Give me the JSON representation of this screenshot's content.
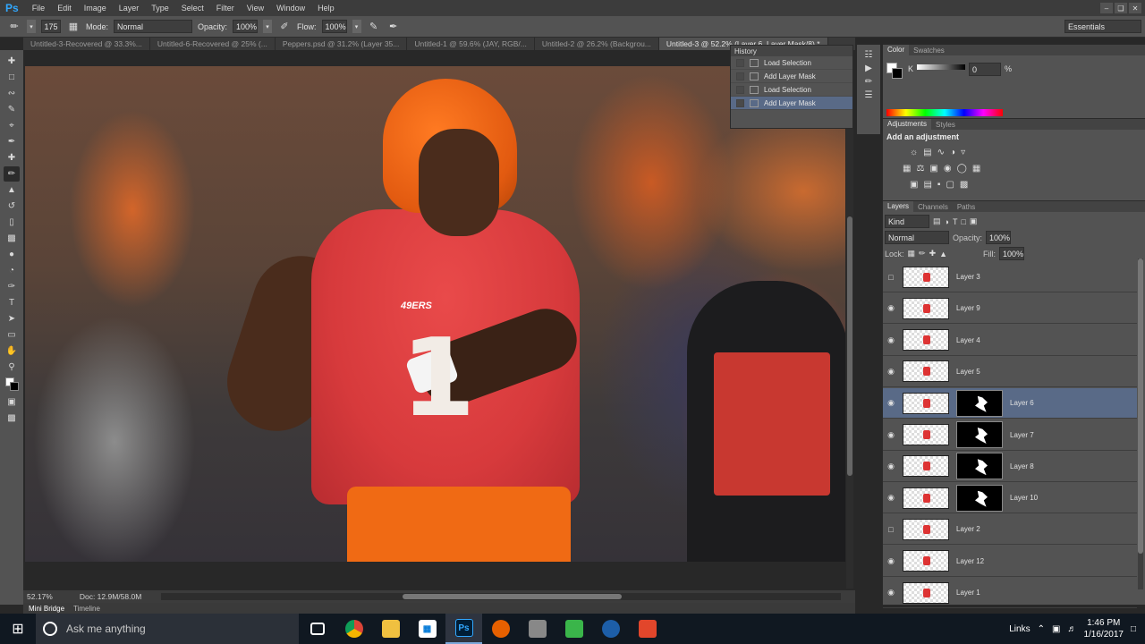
{
  "app": {
    "logo": "Ps"
  },
  "menu": [
    "File",
    "Edit",
    "Image",
    "Layer",
    "Type",
    "Select",
    "Filter",
    "View",
    "Window",
    "Help"
  ],
  "options": {
    "brush_size": "175",
    "mode_label": "Mode:",
    "mode_value": "Normal",
    "opacity_label": "Opacity:",
    "opacity_value": "100%",
    "flow_label": "Flow:",
    "flow_value": "100%",
    "workspace": "Essentials"
  },
  "tabs": [
    "Untitled-3-Recovered @ 33.3%...",
    "Untitled-6-Recovered @ 25% (...",
    "Peppers.psd @ 31.2% (Layer 35...",
    "Untitled-1 @ 59.6% (JAY, RGB/...",
    "Untitled-2 @ 26.2% (Backgrou...",
    "Untitled-3 @ 52.2% (Layer 6, Layer Mask/8) *"
  ],
  "photo": {
    "jersey_logo": "49ERS",
    "jersey_number": "1"
  },
  "status": {
    "zoom": "52.17%",
    "doc": "Doc: 12.9M/58.0M"
  },
  "bottom_tabs": {
    "bridge": "Mini Bridge",
    "timeline": "Timeline"
  },
  "history": {
    "title": "History",
    "items": [
      "Load Selection",
      "Add Layer Mask",
      "Load Selection",
      "Add Layer Mask"
    ]
  },
  "color_panel": {
    "tab1": "Color",
    "tab2": "Swatches",
    "k_label": "K",
    "k_value": "0",
    "unit": "%"
  },
  "adjustments": {
    "tab1": "Adjustments",
    "tab2": "Styles",
    "heading": "Add an adjustment"
  },
  "layers_panel": {
    "tab1": "Layers",
    "tab2": "Channels",
    "tab3": "Paths",
    "kind": "Kind",
    "blend": "Normal",
    "opacity_label": "Opacity:",
    "opacity_value": "100%",
    "lock_label": "Lock:",
    "fill_label": "Fill:",
    "fill_value": "100%",
    "layers": [
      {
        "name": "Layer 3",
        "visible": false,
        "mask": false
      },
      {
        "name": "Layer 9",
        "visible": true,
        "mask": false
      },
      {
        "name": "Layer 4",
        "visible": true,
        "mask": false
      },
      {
        "name": "Layer 5",
        "visible": true,
        "mask": false
      },
      {
        "name": "Layer 6",
        "visible": true,
        "mask": true,
        "selected": true
      },
      {
        "name": "Layer 7",
        "visible": true,
        "mask": true
      },
      {
        "name": "Layer 8",
        "visible": true,
        "mask": true
      },
      {
        "name": "Layer 10",
        "visible": true,
        "mask": true
      },
      {
        "name": "Layer 2",
        "visible": false,
        "mask": false
      },
      {
        "name": "Layer 12",
        "visible": true,
        "mask": false
      },
      {
        "name": "Layer 1",
        "visible": true,
        "mask": false
      }
    ]
  },
  "taskbar": {
    "search_placeholder": "Ask me anything",
    "links": "Links",
    "time": "1:46 PM",
    "date": "1/16/2017"
  },
  "colors": {
    "accent_selection": "#596a87",
    "ps_blue": "#31a8ff"
  }
}
